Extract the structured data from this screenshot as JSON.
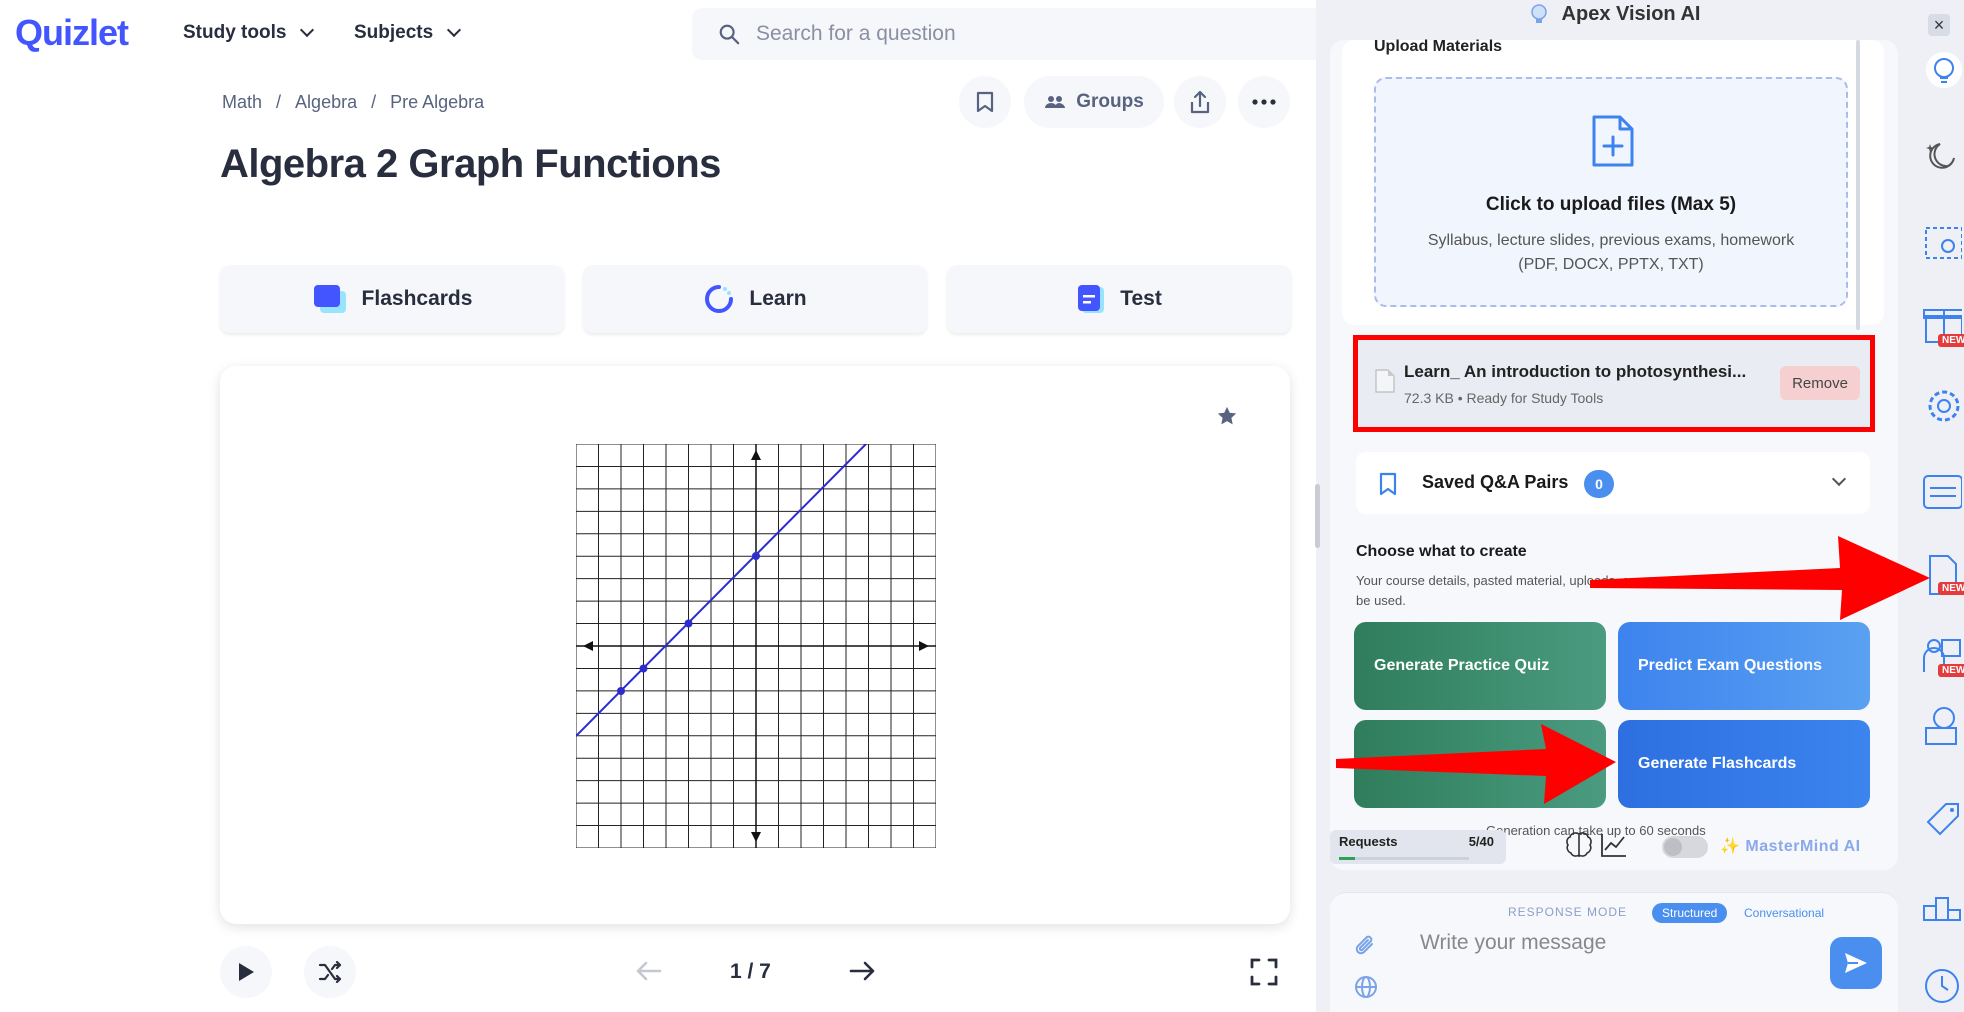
{
  "quizlet": {
    "logo": "Quizlet",
    "nav": {
      "study_tools": "Study tools",
      "subjects": "Subjects"
    },
    "search_placeholder": "Search for a question",
    "breadcrumb": [
      "Math",
      "Algebra",
      "Pre Algebra"
    ],
    "breadcrumb_sep": "/",
    "title": "Algebra 2 Graph Functions",
    "groups_label": "Groups",
    "modes": {
      "flashcards": "Flashcards",
      "learn": "Learn",
      "test": "Test"
    },
    "pager": "1 / 7"
  },
  "apex": {
    "title": "Apex Vision AI",
    "upload_label": "Upload Materials",
    "dropzone_title": "Click to upload files (Max 5)",
    "dropzone_sub1": "Syllabus, lecture slides, previous exams, homework",
    "dropzone_sub2": "(PDF, DOCX, PPTX, TXT)",
    "file": {
      "name": "Learn_ An introduction to photosynthesi...",
      "meta": "72.3 KB • Ready for Study Tools",
      "remove": "Remove"
    },
    "saved_label": "Saved Q&A Pairs",
    "saved_count": "0",
    "choose_title": "Choose what to create",
    "choose_sub": "Your course details, pasted material, uploads, or",
    "choose_sub2": "be used.",
    "buttons": {
      "practice_quiz": "Generate Practice Quiz",
      "predict_exam": "Predict Exam Questions",
      "flashcards": "Generate Flashcards"
    },
    "gen_note": "Generation can take up to 60 seconds",
    "requests_label": "Requests",
    "requests_value": "5/40",
    "requests_fraction": 0.125,
    "mastermind": "✨ MasterMind AI",
    "response_mode": "RESPONSE MODE",
    "mode_structured": "Structured",
    "mode_conversational": "Conversational",
    "message_placeholder": "Write your message"
  },
  "rail": {
    "new_badge": "NEW",
    "close": "×"
  },
  "colors": {
    "quizlet_blue": "#4255ff",
    "graph_line": "#2c2ccf",
    "annotation_red": "#ff0000"
  }
}
